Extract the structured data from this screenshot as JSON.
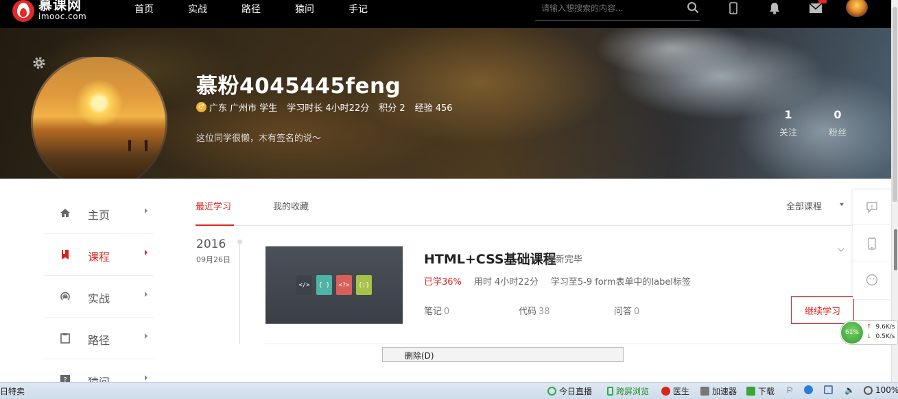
{
  "header": {
    "logo_big": "慕课网",
    "logo_small": "imooc.com",
    "nav": [
      "首页",
      "实战",
      "路径",
      "猿问",
      "手记"
    ],
    "search_placeholder": "请输入想搜索的内容..."
  },
  "profile": {
    "username": "慕粉4045445feng",
    "gender_icon": "♂",
    "location": "广东 广州市 学生",
    "study_time": "学习时长 4小时22分",
    "points": "积分 2",
    "experience": "经验 456",
    "signature": "这位同学很懒，木有签名的说～",
    "following_count": "1",
    "following_label": "关注",
    "fans_count": "0",
    "fans_label": "粉丝"
  },
  "sidebar": {
    "items": [
      {
        "label": "主页",
        "icon": "home-icon"
      },
      {
        "label": "课程",
        "icon": "book-icon"
      },
      {
        "label": "实战",
        "icon": "broadcast-icon"
      },
      {
        "label": "路径",
        "icon": "clipboard-icon"
      },
      {
        "label": "猿问",
        "icon": "question-icon"
      }
    ],
    "active_index": 1
  },
  "tabs": {
    "items": [
      "最近学习",
      "我的收藏"
    ],
    "filter": "全部课程"
  },
  "timeline": {
    "year": "2016",
    "date": "09月26日"
  },
  "course": {
    "title": "HTML+CSS基础课程",
    "status": "更新完毕",
    "progress": "已学36%",
    "time_spent": "用时 4小时22分",
    "last_lesson": "学习至5-9 form表单中的label标签",
    "notes_label": "笔记",
    "notes_count": "0",
    "code_label": "代码",
    "code_count": "38",
    "qa_label": "问答",
    "qa_count": "0",
    "continue_label": "继续学习",
    "thumb_files": [
      "</>",
      "{ }",
      "<?>",
      "{;}"
    ]
  },
  "context_menu": {
    "item": "删除(D)"
  },
  "speed_widget": {
    "percent": "61%",
    "upload": "9.6K/s",
    "download": "0.5K/s"
  },
  "statusbar": {
    "left": "日特卖",
    "items": [
      "今日直播",
      "跨屏浏览",
      "医生",
      "加速器",
      "下载"
    ],
    "zoom": "100%"
  },
  "colors": {
    "accent": "#d9251d",
    "nav_bg": "#000000"
  }
}
